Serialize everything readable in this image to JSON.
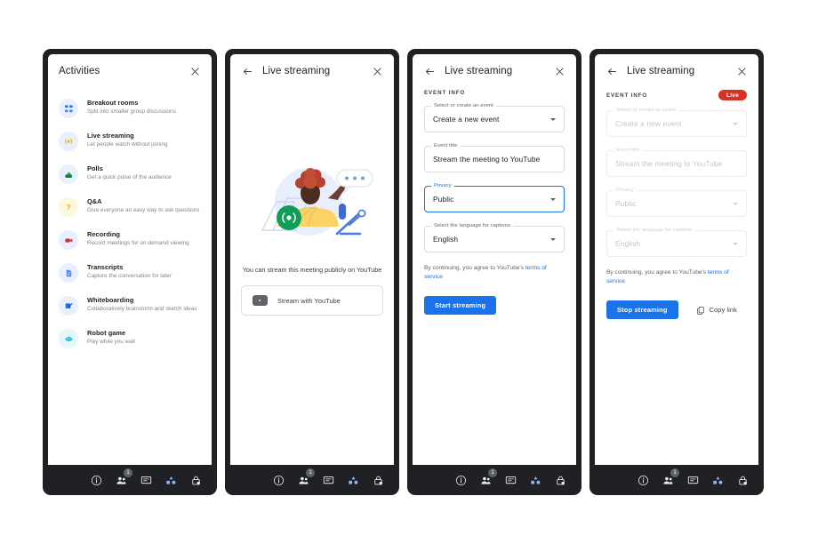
{
  "colors": {
    "accent": "#1a73e8",
    "live_red": "#d93025",
    "frame": "#202124",
    "muted_text": "#80868b",
    "border": "#dadce0"
  },
  "panels": [
    {
      "id": "activities",
      "title": "Activities",
      "has_back": false,
      "close_icon": "close-icon",
      "activities": [
        {
          "name": "Breakout rooms",
          "desc": "Split into smaller group discussions",
          "icon": "breakout-rooms-icon",
          "color": "#1a73e8",
          "bg": "#e8f0fe"
        },
        {
          "name": "Live streaming",
          "desc": "Let people watch without joining",
          "icon": "live-streaming-icon",
          "color": "#f9ab00",
          "bg": "#e8f0fe"
        },
        {
          "name": "Polls",
          "desc": "Get a quick pulse of the audience",
          "icon": "polls-icon",
          "color": "#188038",
          "bg": "#e6f4ea"
        },
        {
          "name": "Q&A",
          "desc": "Give everyone an easy way to ask questions",
          "icon": "qa-icon",
          "color": "#f9ab00",
          "bg": "#fef7e0"
        },
        {
          "name": "Recording",
          "desc": "Record meetings for on-demand viewing",
          "icon": "recording-icon",
          "color": "#d93025",
          "bg": "#e8f0fe"
        },
        {
          "name": "Transcripts",
          "desc": "Capture the conversation for later",
          "icon": "transcripts-icon",
          "color": "#1a73e8",
          "bg": "#e8f0fe"
        },
        {
          "name": "Whiteboarding",
          "desc": "Collaboratively brainstorm and sketch ideas",
          "icon": "whiteboarding-icon",
          "color": "#1a73e8",
          "bg": "#e8f0fe"
        },
        {
          "name": "Robot game",
          "desc": "Play while you wait",
          "icon": "robot-game-icon",
          "color": "#12b5cb",
          "bg": "#e4f7fb"
        }
      ]
    },
    {
      "id": "live-streaming-promo",
      "title": "Live streaming",
      "has_back": true,
      "caption": "You can stream this meeting publicly on YouTube",
      "stream_button": "Stream with YouTube"
    },
    {
      "id": "live-streaming-form",
      "title": "Live streaming",
      "has_back": true,
      "section_label": "EVENT INFO",
      "live_badge": null,
      "disabled": false,
      "fields": [
        {
          "label": "Select or create an event",
          "value": "Create a new event",
          "type": "select",
          "focused": false
        },
        {
          "label": "Event title",
          "value": "Stream the meeting to YouTube",
          "type": "text",
          "focused": false
        },
        {
          "label": "Privacy",
          "value": "Public",
          "type": "select",
          "focused": true
        },
        {
          "label": "Select the language for captions",
          "value": "English",
          "type": "select",
          "focused": false
        }
      ],
      "tos_prefix": "By continuing, you agree to YouTube's ",
      "tos_link": "terms of service",
      "primary_button": "Start streaming",
      "secondary_button": null
    },
    {
      "id": "live-streaming-active",
      "title": "Live streaming",
      "has_back": true,
      "section_label": "EVENT INFO",
      "live_badge": "Live",
      "disabled": true,
      "fields": [
        {
          "label": "Select or create an event",
          "value": "Create a new event",
          "type": "select",
          "focused": false
        },
        {
          "label": "Event title",
          "value": "Stream the meeting to YouTube",
          "type": "text",
          "focused": false
        },
        {
          "label": "Privacy",
          "value": "Public",
          "type": "select",
          "focused": false
        },
        {
          "label": "Select the language for captions",
          "value": "English",
          "type": "select",
          "focused": false
        }
      ],
      "tos_prefix": "By continuing, you agree to YouTube's ",
      "tos_link": "terms of service",
      "primary_button": "Stop streaming",
      "secondary_button": "Copy link"
    }
  ],
  "control_bar": {
    "items": [
      {
        "icon": "meeting-details-info-icon",
        "badge": null
      },
      {
        "icon": "people-icon",
        "badge": "1"
      },
      {
        "icon": "chat-icon",
        "badge": null
      },
      {
        "icon": "activities-icon",
        "badge": null
      },
      {
        "icon": "host-controls-lock-icon",
        "badge": null
      }
    ]
  }
}
